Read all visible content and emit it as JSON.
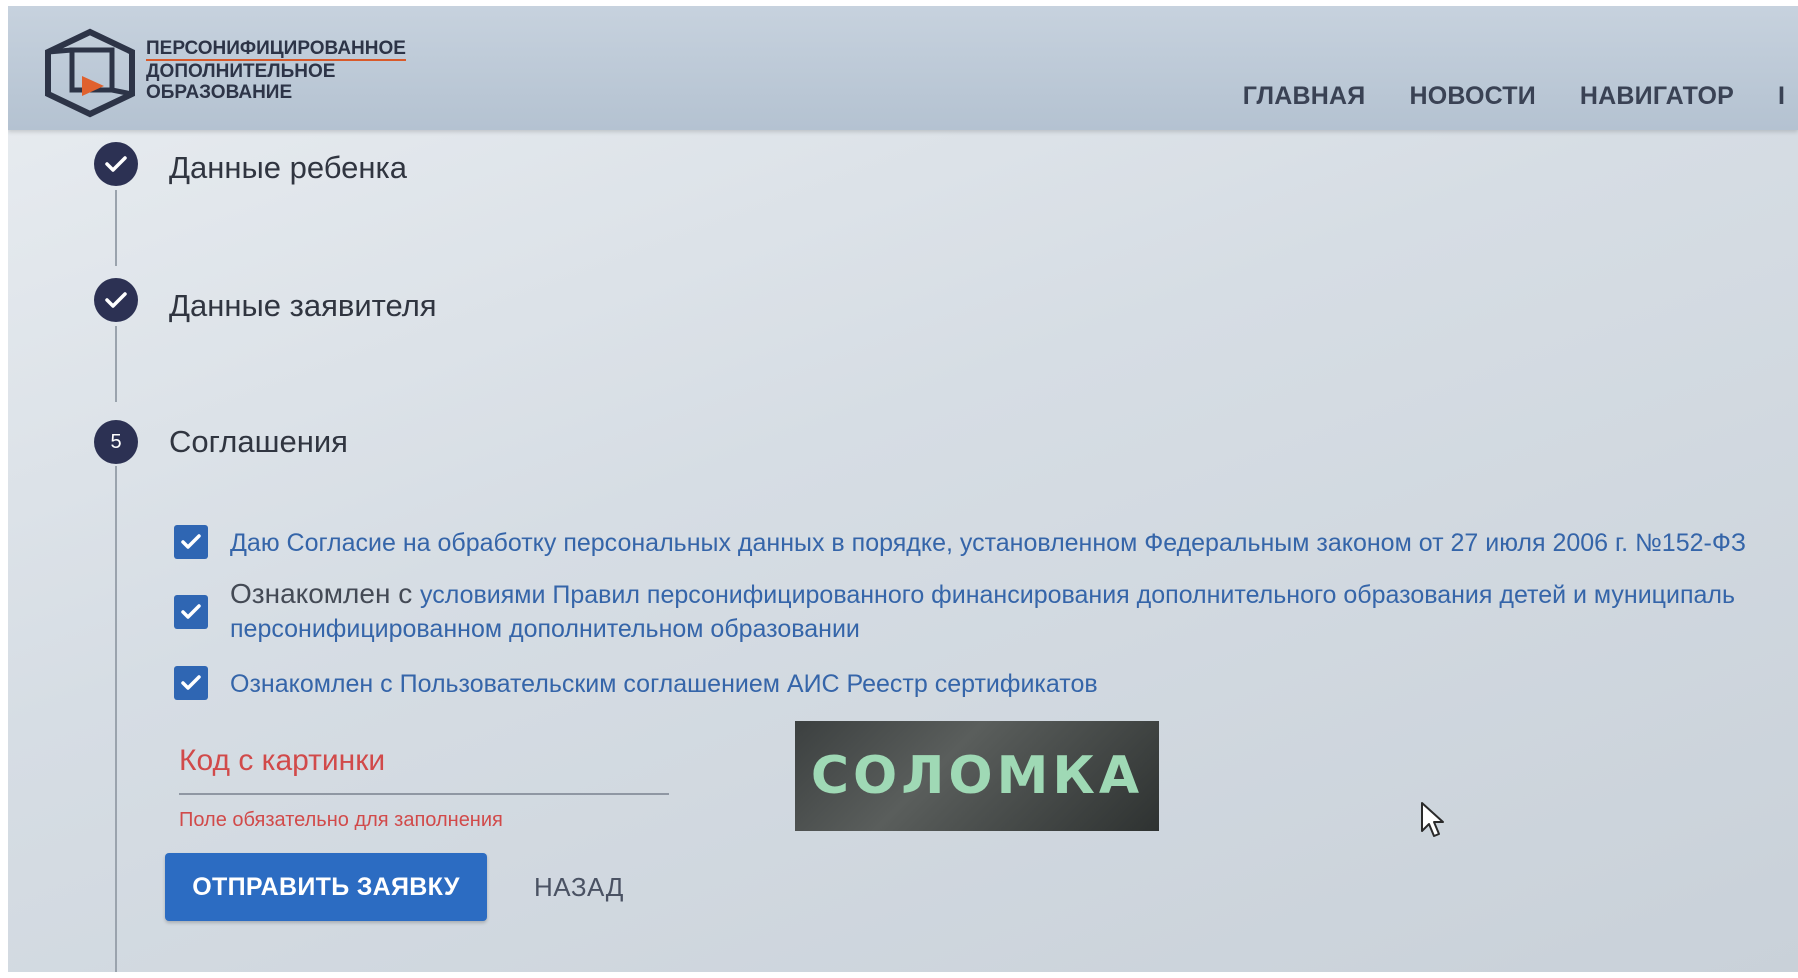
{
  "header": {
    "logo_lines": [
      "ПЕРСОНИФИЦИРОВАННОЕ",
      "ДОПОЛНИТЕЛЬНОЕ",
      "ОБРАЗОВАНИЕ"
    ],
    "nav": [
      "ГЛАВНАЯ",
      "НОВОСТИ",
      "НАВИГАТОР",
      "I"
    ]
  },
  "steps": [
    {
      "title": "Данные ребенка",
      "state": "done",
      "icon": "check-icon"
    },
    {
      "title": "Данные заявителя",
      "state": "done",
      "icon": "check-icon"
    },
    {
      "title": "Соглашения",
      "state": "active",
      "number": "5"
    }
  ],
  "agreements": [
    {
      "checked": true,
      "prefix": "",
      "text": "Даю Согласие на обработку персональных данных в порядке, установленном Федеральным законом от 27 июля 2006 г. №152-ФЗ"
    },
    {
      "checked": true,
      "prefix": "Ознакомлен с ",
      "text": "условиями Правил персонифицированного финансирования дополнительного образования детей и муниципаль",
      "text2": "персонифицированном дополнительном образовании"
    },
    {
      "checked": true,
      "prefix": "",
      "text": "Ознакомлен с Пользовательским соглашением АИС Реестр сертификатов"
    }
  ],
  "captcha": {
    "placeholder": "Код с картинки",
    "error": "Поле обязательно для заполнения",
    "image_text": "СОЛОМКА"
  },
  "buttons": {
    "submit": "ОТПРАВИТЬ ЗАЯВКУ",
    "back": "НАЗАД"
  },
  "colors": {
    "step_icon": "#2c3153",
    "checkbox": "#2f66b3",
    "link_text": "#3565a9",
    "error": "#d14a4a",
    "primary_button": "#2c6cc2"
  }
}
